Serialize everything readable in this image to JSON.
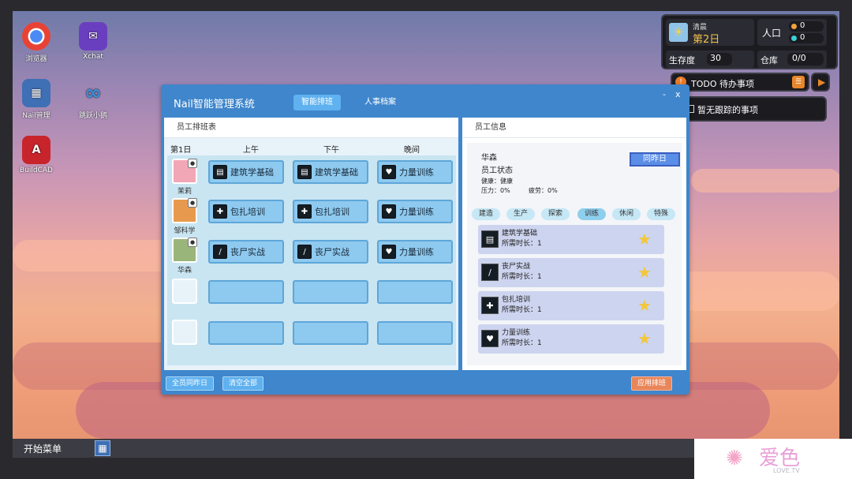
{
  "desktop": {
    "icons": [
      {
        "label": "浏览器",
        "icon": "chrome-icon",
        "color": "#e94235"
      },
      {
        "label": "Xchat",
        "icon": "xchat-icon",
        "color": "#6a3fbf"
      },
      {
        "label": "Nail管理",
        "icon": "calendar-grid-icon",
        "color": "#3f6fb5"
      },
      {
        "label": "跳跃小鹅",
        "icon": "loop-icon",
        "color": "#3a8fd8"
      },
      {
        "label": "BuildCAD",
        "icon": "cad-icon",
        "color": "#c8242c"
      }
    ]
  },
  "hud": {
    "time_of_day": "清晨",
    "day": "第2日",
    "population_label": "人口",
    "pop_a": "0",
    "pop_b": "0",
    "survival_label": "生存度",
    "survival_value": "30",
    "storage_label": "仓库",
    "storage_value": "0/0",
    "todo_label": "TODO 待办事项",
    "no_tracking": "暂无跟踪的事项"
  },
  "window": {
    "title": "Nail智能管理系统",
    "tabs": [
      {
        "label": "智能排班",
        "active": true
      },
      {
        "label": "人事档案",
        "active": false
      }
    ],
    "minimize": "-",
    "close": "x",
    "schedule_panel_title": "员工排班表",
    "info_panel_title": "员工信息",
    "day_label": "第1日",
    "columns": [
      "上午",
      "下午",
      "晚间"
    ],
    "rows": [
      {
        "name": "茉莉",
        "avatar_color": "#f2a7b6",
        "slots": [
          {
            "label": "建筑学基础",
            "icon": "book-icon"
          },
          {
            "label": "建筑学基础",
            "icon": "book-icon"
          },
          {
            "label": "力量训练",
            "icon": "muscle-icon"
          }
        ]
      },
      {
        "name": "邹科学",
        "avatar_color": "#e79a4e",
        "slots": [
          {
            "label": "包扎培训",
            "icon": "plus-icon"
          },
          {
            "label": "包扎培训",
            "icon": "plus-icon"
          },
          {
            "label": "力量训练",
            "icon": "muscle-icon"
          }
        ]
      },
      {
        "name": "华森",
        "avatar_color": "#9ab57a",
        "slots": [
          {
            "label": "丧尸实战",
            "icon": "knife-icon"
          },
          {
            "label": "丧尸实战",
            "icon": "knife-icon"
          },
          {
            "label": "力量训练",
            "icon": "muscle-icon"
          }
        ]
      },
      {
        "name": "",
        "avatar_color": "",
        "slots": [
          {
            "label": "",
            "icon": ""
          },
          {
            "label": "",
            "icon": ""
          },
          {
            "label": "",
            "icon": ""
          }
        ]
      },
      {
        "name": "",
        "avatar_color": "",
        "slots": [
          {
            "label": "",
            "icon": ""
          },
          {
            "label": "",
            "icon": ""
          },
          {
            "label": "",
            "icon": ""
          }
        ]
      }
    ],
    "employee": {
      "name": "华森",
      "status_title": "员工状态",
      "health": "健康：健康",
      "stress": "压力：0%",
      "fatigue": "疲劳：0%",
      "same_as_yesterday": "同昨日"
    },
    "categories": [
      {
        "label": "建造",
        "active": false
      },
      {
        "label": "生产",
        "active": false
      },
      {
        "label": "探索",
        "active": false
      },
      {
        "label": "训练",
        "active": true
      },
      {
        "label": "休闲",
        "active": false
      },
      {
        "label": "特殊",
        "active": false
      }
    ],
    "skills": [
      {
        "name": "建筑学基础",
        "duration": "所需时长：1",
        "icon": "book-icon"
      },
      {
        "name": "丧尸实战",
        "duration": "所需时长：1",
        "icon": "knife-icon"
      },
      {
        "name": "包扎培训",
        "duration": "所需时长：1",
        "icon": "plus-icon"
      },
      {
        "name": "力量训练",
        "duration": "所需时长：1",
        "icon": "muscle-icon"
      }
    ],
    "footer": {
      "all_same": "全员同昨日",
      "clear_all": "清空全部",
      "apply": "应用排班"
    }
  },
  "taskbar": {
    "start": "开始菜单"
  },
  "watermark": {
    "text": "爱色",
    "sub": "LOVE.TV"
  }
}
